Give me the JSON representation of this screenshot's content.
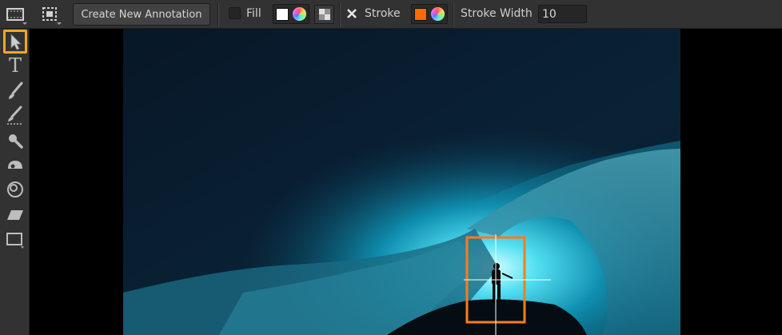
{
  "toolbar": {
    "create_annotation_label": "Create New Annotation",
    "fill_label": "Fill",
    "fill_color": "#ffffff",
    "stroke_label": "Stroke",
    "stroke_color": "#ff6a00",
    "stroke_width_label": "Stroke Width",
    "stroke_width_value": "10"
  },
  "tools": [
    {
      "name": "select-tool",
      "icon": "arrow-pointer-icon",
      "active": true
    },
    {
      "name": "text-tool",
      "icon": "text-icon",
      "glyph": "T"
    },
    {
      "name": "brush-tool",
      "icon": "brush-icon"
    },
    {
      "name": "brush-dotted-tool",
      "icon": "brush-dotted-icon"
    },
    {
      "name": "magnifier-tool",
      "icon": "magnifier-icon"
    },
    {
      "name": "smudge-tool",
      "icon": "smudge-icon"
    },
    {
      "name": "clone-tool",
      "icon": "clone-icon"
    },
    {
      "name": "eraser-tool",
      "icon": "eraser-icon"
    },
    {
      "name": "rectangle-tool",
      "icon": "rectangle-icon"
    }
  ],
  "colors": {
    "accent": "#f5a623",
    "annotation_box": "#ff7a1a",
    "panel": "#323232"
  }
}
